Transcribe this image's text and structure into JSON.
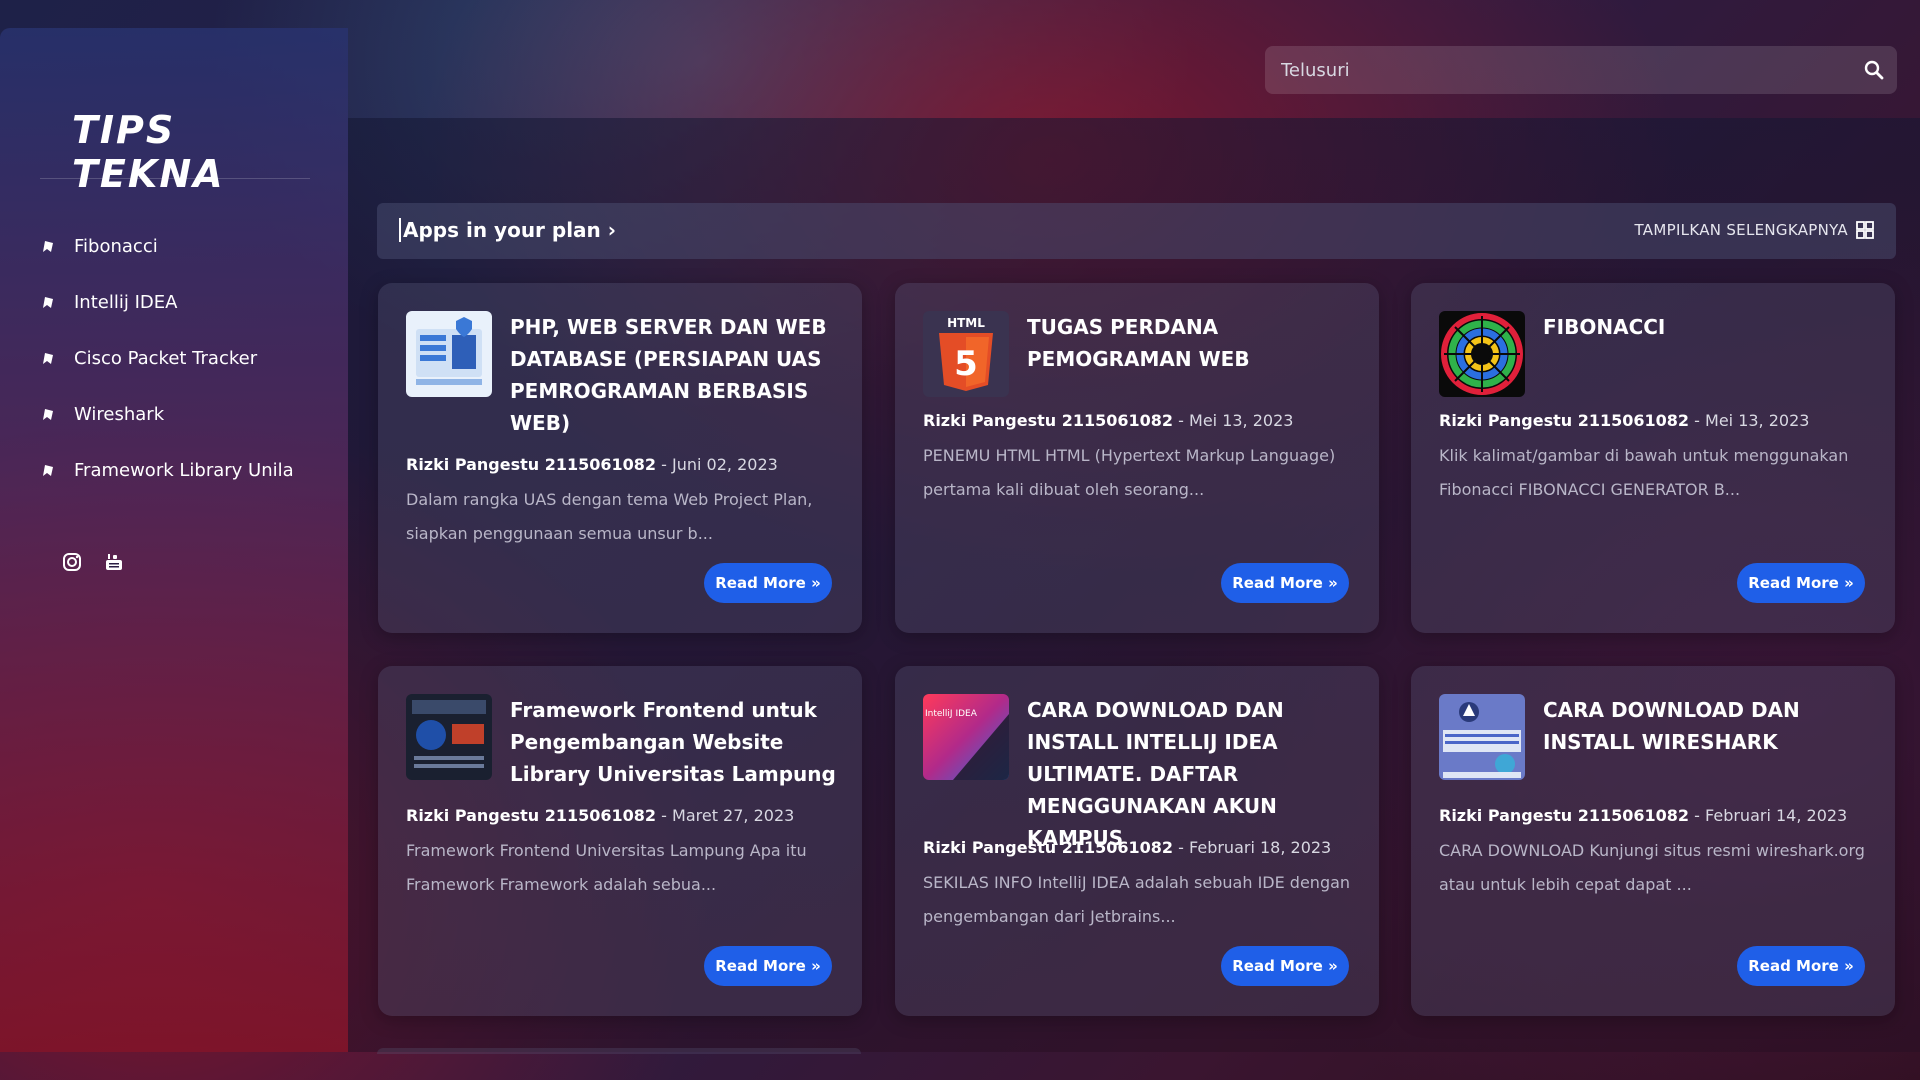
{
  "sidebar": {
    "logo": "TIPS TEKNA",
    "items": [
      {
        "label": "Fibonacci"
      },
      {
        "label": "Intellij IDEA"
      },
      {
        "label": "Cisco Packet Tracker"
      },
      {
        "label": "Wireshark"
      },
      {
        "label": "Framework Library Unila"
      }
    ],
    "social": [
      "instagram-icon",
      "youtube-icon"
    ]
  },
  "search": {
    "placeholder": "Telusuri"
  },
  "section": {
    "title": "Apps in your plan",
    "more_label": "TAMPILKAN SELENGKAPNYA"
  },
  "cards": [
    {
      "title": "PHP, WEB SERVER DAN WEB DATABASE (PERSIAPAN UAS PEMROGRAMAN BERBASIS WEB)",
      "author": "Rizki Pangestu 2115061082",
      "date": "Juni 02, 2023",
      "excerpt": "Dalam rangka UAS dengan tema Web Project Plan, siapkan penggunaan semua unsur b...",
      "read_more": "Read More »"
    },
    {
      "title": "TUGAS PERDANA PEMOGRAMAN WEB",
      "author": "Rizki Pangestu 2115061082",
      "date": "Mei 13, 2023",
      "excerpt": "PENEMU HTML HTML (Hypertext Markup Language) pertama kali dibuat oleh seorang...",
      "read_more": "Read More »",
      "thumb_text": "HTML"
    },
    {
      "title": "FIBONACCI",
      "author": "Rizki Pangestu 2115061082",
      "date": "Mei 13, 2023",
      "excerpt": "Klik kalimat/gambar di bawah untuk menggunakan Fibonacci FIBONACCI GENERATOR B...",
      "read_more": "Read More »"
    },
    {
      "title": "Framework Frontend untuk Pengembangan Website Library Universitas Lampung",
      "author": "Rizki Pangestu 2115061082",
      "date": "Maret 27, 2023",
      "excerpt": "Framework Frontend Universitas Lampung Apa itu Framework Framework adalah sebua...",
      "read_more": "Read More »"
    },
    {
      "title": "CARA DOWNLOAD DAN INSTALL INTELLIJ IDEA ULTIMATE. DAFTAR MENGGUNAKAN AKUN KAMPUS",
      "author": "Rizki Pangestu 2115061082",
      "date": "Februari 18, 2023",
      "excerpt": "SEKILAS INFO IntelliJ IDEA adalah sebuah IDE dengan pengembangan dari Jetbrains...",
      "read_more": "Read More »",
      "thumb_text": "IntelliJ IDEA"
    },
    {
      "title": "CARA DOWNLOAD DAN INSTALL WIRESHARK",
      "author": "Rizki Pangestu 2115061082",
      "date": "Februari 14, 2023",
      "excerpt": "CARA DOWNLOAD Kunjungi situs resmi wireshark.org  atau untuk lebih cepat dapat ...",
      "read_more": "Read More »"
    }
  ]
}
